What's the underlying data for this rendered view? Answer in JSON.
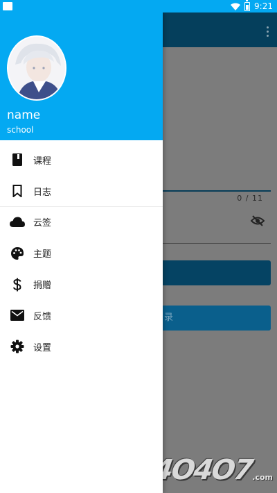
{
  "status_bar": {
    "time": "9:21"
  },
  "profile": {
    "name": "name",
    "school": "school"
  },
  "menu": {
    "items": [
      {
        "label": "课程",
        "icon": "book-icon"
      },
      {
        "label": "日志",
        "icon": "bookmark-icon"
      },
      {
        "label": "云签",
        "icon": "cloud-icon"
      },
      {
        "label": "主题",
        "icon": "palette-icon"
      },
      {
        "label": "捐赠",
        "icon": "dollar-icon"
      },
      {
        "label": "反馈",
        "icon": "mail-icon"
      },
      {
        "label": "设置",
        "icon": "gear-icon"
      }
    ]
  },
  "background": {
    "password_counter": "0 / 11",
    "secondary_button_label": "录"
  },
  "watermark": {
    "main": "4O4O7",
    "tld": ".com"
  },
  "colors": {
    "header": "#04a9f2",
    "toolbar_dimmed": "#053f5c"
  }
}
